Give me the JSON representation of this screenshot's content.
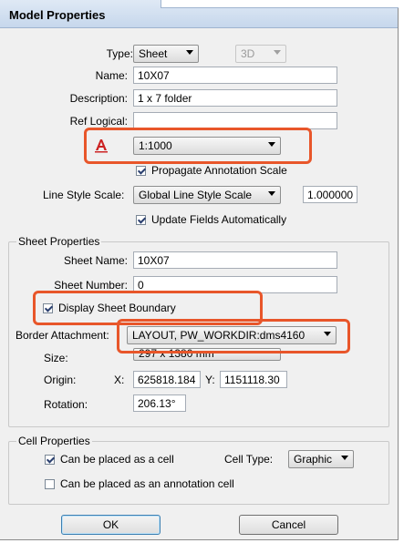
{
  "dialog": {
    "title": "Model Properties",
    "type_label": "Type:",
    "type_value": "Sheet",
    "mode_value": "3D",
    "name_label": "Name:",
    "name_value": "10X07",
    "description_label": "Description:",
    "description_value": "1 x 7 folder",
    "ref_logical_label": "Ref Logical:",
    "ref_logical_value": "",
    "annotation_scale_value": "1:1000",
    "propagate_label": "Propagate Annotation Scale",
    "propagate_checked": true,
    "line_style_scale_label": "Line Style Scale:",
    "line_style_scale_value": "Global Line Style Scale",
    "line_style_scale_number": "1.000000",
    "update_fields_label": "Update Fields Automatically",
    "update_fields_checked": true
  },
  "sheet_properties": {
    "title": "Sheet Properties",
    "sheet_name_label": "Sheet Name:",
    "sheet_name_value": "10X07",
    "sheet_number_label": "Sheet Number:",
    "sheet_number_value": "0",
    "display_boundary_label": "Display Sheet Boundary",
    "display_boundary_checked": true,
    "border_attachment_label": "Border Attachment:",
    "border_attachment_value": "LAYOUT, PW_WORKDIR:dms4160",
    "size_label": "Size:",
    "size_value": "297 x 1380 mm",
    "origin_label": "Origin:",
    "x_label": "X:",
    "origin_x": "625818.184",
    "y_label": "Y:",
    "origin_y": "1151118.30",
    "rotation_label": "Rotation:",
    "rotation_value": "206.13°"
  },
  "cell_properties": {
    "title": "Cell Properties",
    "placed_as_cell_label": "Can be placed as a cell",
    "placed_as_cell_checked": true,
    "cell_type_label": "Cell Type:",
    "cell_type_value": "Graphic",
    "annotation_cell_label": "Can be placed as an annotation cell",
    "annotation_cell_checked": false
  },
  "buttons": {
    "ok": "OK",
    "cancel": "Cancel"
  },
  "colors": {
    "highlight": "#e8562a",
    "annotation_icon": "#cc2222"
  }
}
